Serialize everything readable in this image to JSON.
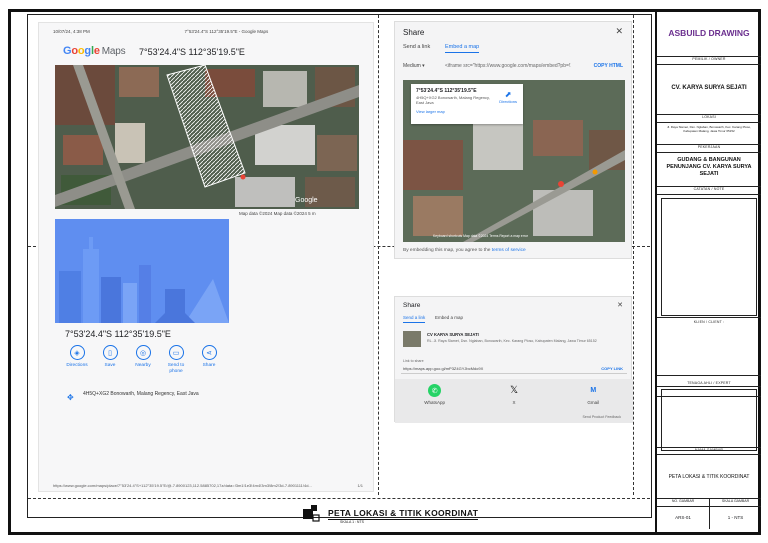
{
  "print_page": {
    "header_left": "10/07/24, 4:38 PM",
    "header_center": "7°53'24.4\"S 112°35'19.5\"E - Google Maps",
    "logo_g": "G",
    "logo_o1": "o",
    "logo_o2": "o",
    "logo_g2": "g",
    "logo_l": "l",
    "logo_e": "e",
    "logo_maps": "Maps",
    "coord_top": "7°53'24.4\"S 112°35'19.5\"E",
    "map_footer": "Map data ©2024   Map data ©2024    5 m",
    "coord_big": "7°53'24.4\"S 112°35'19.5\"E",
    "actions": [
      {
        "label": "Directions",
        "icon": "directions-icon"
      },
      {
        "label": "Save",
        "icon": "bookmark-icon"
      },
      {
        "label": "Nearby",
        "icon": "nearby-icon"
      },
      {
        "label": "Send to phone",
        "icon": "phone-icon"
      },
      {
        "label": "Share",
        "icon": "share-icon"
      }
    ],
    "plus_code": "4H5Q+XG2 Bonowarih, Malang Regency, East Java",
    "url_footer": "https://www.google.com/maps/place/7°53'24.4\"S+112°35'19.5\"E/@-7.8900123,112.5885702,17z/data=!3m1!1e3!4m4!3m3!8m2!3d-7.8901111!4d...",
    "page_num": "1/1",
    "google_watermark": "Google"
  },
  "share_embed": {
    "title": "Share",
    "tab_send": "Send a link",
    "tab_embed": "Embed a map",
    "size": "Medium ▾",
    "code": "<iframe src=\"https://www.google.com/maps/embed?pb=!1m17!1m12",
    "copy": "COPY HTML",
    "card_title": "7°53'24.4\"S 112°35'19.5\"E",
    "card_address": "4H5Q+XG2 Bonowarih, Malang Regency, East Java",
    "card_link": "View larger map",
    "card_directions": "Directions",
    "terms_prefix": "By embedding this map, you agree to the ",
    "terms_link": "terms of service",
    "map_footer": "Keyboard shortcuts   Map data ©2024   Terms   Report a map error"
  },
  "share_link": {
    "title": "Share",
    "tab_send": "Send a link",
    "tab_embed": "Embed a map",
    "place_name": "CV KARYA SURYA SEJATI",
    "place_address": "RL. Jl. Raya Slamet, Dsn. Nglaban, Bonowarih, Kec. Karang Ploso, Kabupaten Malang, Jawa Timur 65152",
    "link_label": "Link to share",
    "link_url": "https://maps.app.goo.gl/mP3Z4GYJbcMdo9X",
    "copy": "COPY LINK",
    "apps": [
      {
        "label": "WhatsApp",
        "icon": "whatsapp-icon",
        "color": "#25d366",
        "glyph": "✆"
      },
      {
        "label": "X",
        "icon": "x-icon",
        "color": "#111111",
        "glyph": "𝕏"
      },
      {
        "label": "Gmail",
        "icon": "gmail-icon",
        "color": "#1a73e8",
        "glyph": "M"
      }
    ],
    "feedback": "Send Product Feedback"
  },
  "title_block": {
    "head": "ASBUILD DRAWING",
    "owner_label": "PEMILIK / OWNER",
    "owner": "CV. KARYA SURYA SEJATI",
    "location_label": "LOKASI",
    "location": "Jl. Raya Slamet, Dsn. Nglaban, Bonowarih, Kec. Karang Ploso, Kabupaten Malang, Jawa Timur 65152",
    "work_label": "PEKERJAAN",
    "work": "GUDANG & BANGUNAN PENUNJANG CV. KARYA SURYA SEJATI",
    "notes_label": "CATATAN / NOTE",
    "client_label": "KLIEN / CLIENT :",
    "expert_label": "TENAGA AHLI / EXPERT",
    "drawing_name_label": "NAMA GAMBAR",
    "drawing_name": "PETA LOKASI & TITIK KOORDINAT",
    "no_label": "NO. GAMBAR",
    "scale_label": "SKALA GAMBAR",
    "no": "ARS-01",
    "scale": "1 - NTS"
  },
  "bottom_title": {
    "title": "PETA LOKASI & TITIK KOORDINAT",
    "sub": "SKALA 1 : NTS"
  }
}
